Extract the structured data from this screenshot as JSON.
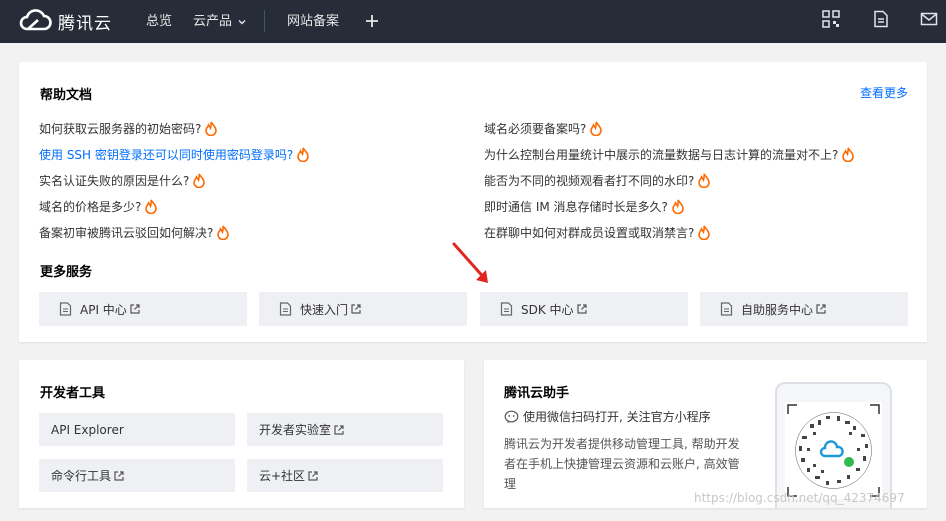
{
  "topbar": {
    "logo_text": "腾讯云",
    "nav": [
      "总览",
      "云产品",
      "网站备案"
    ],
    "icons": [
      "qrcode-icon",
      "document-icon",
      "mail-icon"
    ]
  },
  "help": {
    "title": "帮助文档",
    "more": "查看更多",
    "faqs_left": [
      {
        "text": "如何获取云服务器的初始密码?",
        "link": false
      },
      {
        "text": "使用 SSH 密钥登录还可以同时使用密码登录吗?",
        "link": true
      },
      {
        "text": "实名认证失败的原因是什么?",
        "link": false
      },
      {
        "text": "域名的价格是多少?",
        "link": false
      },
      {
        "text": "备案初审被腾讯云驳回如何解决?",
        "link": false
      }
    ],
    "faqs_right": [
      {
        "text": "域名必须要备案吗?",
        "link": false
      },
      {
        "text": "为什么控制台用量统计中展示的流量数据与日志计算的流量对不上?",
        "link": false
      },
      {
        "text": "能否为不同的视频观看者打不同的水印?",
        "link": false
      },
      {
        "text": "即时通信 IM 消息存储时长是多久?",
        "link": false
      },
      {
        "text": "在群聊中如何对群成员设置或取消禁言?",
        "link": false
      }
    ],
    "services_title": "更多服务",
    "services": [
      "API 中心",
      "快速入门",
      "SDK 中心",
      "自助服务中心"
    ]
  },
  "dev": {
    "title": "开发者工具",
    "items": [
      "API Explorer",
      "开发者实验室",
      "命令行工具",
      "云+社区"
    ]
  },
  "assist": {
    "title": "腾讯云助手",
    "wechat": "使用微信扫码打开, 关注官方小程序",
    "desc": [
      "腾讯云为开发者提供移动管理工具, 帮助开发",
      "者在手机上快捷管理云资源和云账户, 高效管",
      "理"
    ]
  },
  "watermark": "https://blog.csdn.net/qq_42374697",
  "colors": {
    "nav_bg": "#262d38",
    "link": "#006eff",
    "fire": "#ff6a00",
    "tile_bg": "#eef0f4"
  }
}
